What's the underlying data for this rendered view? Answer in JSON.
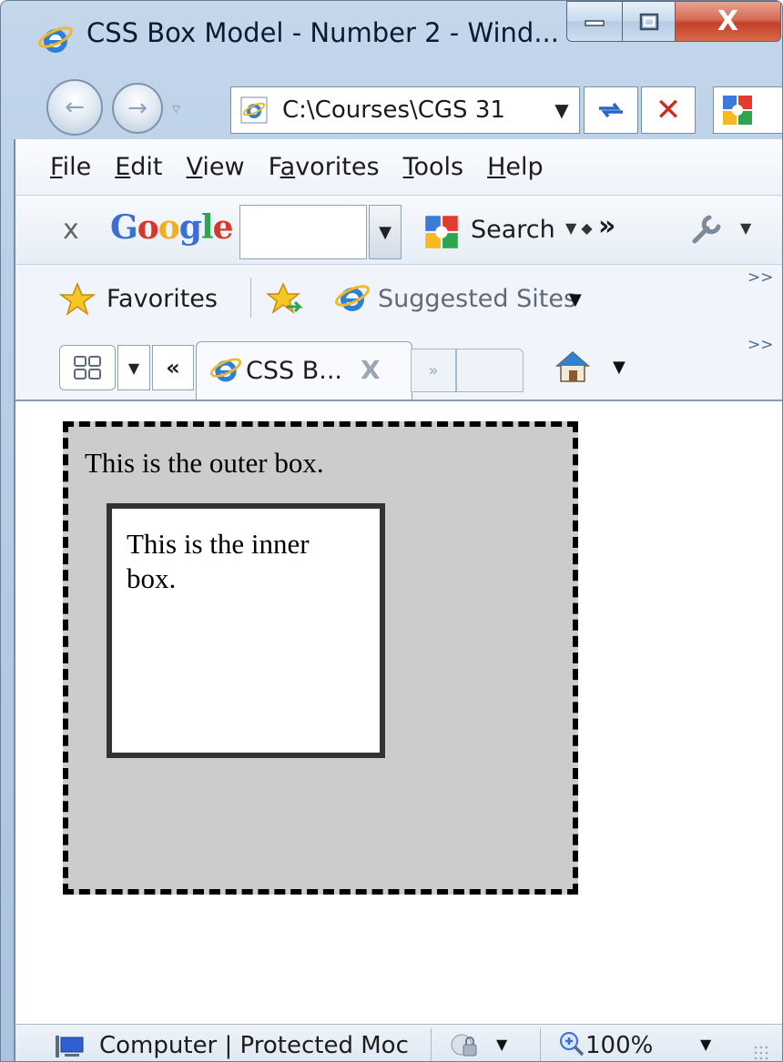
{
  "window": {
    "title": "CSS Box Model - Number 2 - Wind...",
    "minimize_icon": "minimize-icon",
    "maximize_icon": "maximize-icon",
    "close_glyph": "X"
  },
  "nav": {
    "address": "C:\\Courses\\CGS 31",
    "address_icon": "ie-page-icon",
    "colors": {
      "stop": "#d02a1a",
      "refresh": "#2a63c9"
    }
  },
  "menubar": {
    "items": [
      {
        "accel": "F",
        "rest": "ile"
      },
      {
        "accel": "E",
        "rest": "dit"
      },
      {
        "accel": "V",
        "rest": "iew"
      },
      {
        "pre": "F",
        "accel": "a",
        "rest": "vorites"
      },
      {
        "accel": "T",
        "rest": "ools"
      },
      {
        "accel": "H",
        "rest": "elp"
      }
    ]
  },
  "google_toolbar": {
    "close_glyph": "x",
    "logo": "Google",
    "search_label": "Search",
    "search_value": "",
    "more_glyph": "»"
  },
  "favorites_bar": {
    "favorites_label": "Favorites",
    "suggested_label": "Suggested Sites",
    "overflow_glyph": ">>"
  },
  "tabs": {
    "active_label": "CSS B...",
    "close_glyph": "X",
    "scroll_left_glyph": "«",
    "scroll_right_glyph": "»",
    "overflow_glyph": ">>"
  },
  "page": {
    "outer_text": "This is the outer box.",
    "inner_text": "This is the inner box.",
    "colors": {
      "outer_bg": "#cccccc",
      "outer_border": "#000000",
      "inner_bg": "#ffffff",
      "inner_border": "#333333"
    }
  },
  "statusbar": {
    "zone_text": "Computer | Protected Moc",
    "zoom": "100%"
  }
}
